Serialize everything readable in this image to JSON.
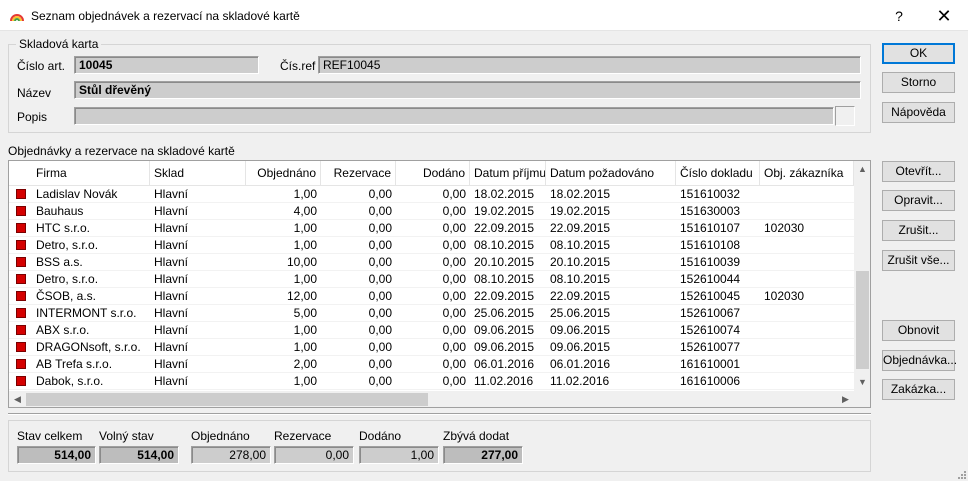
{
  "window": {
    "title": "Seznam objednávek a rezervací na skladové kartě",
    "help_label": "?",
    "close_label": "✕"
  },
  "card": {
    "group_title": "Skladová karta",
    "cislo_art_label": "Číslo art.",
    "cislo_art_value": "10045",
    "cis_ref_label": "Čís.ref",
    "cis_ref_value": "REF10045",
    "nazev_label": "Název",
    "nazev_value": "Stůl dřevěný",
    "popis_label": "Popis",
    "popis_value": ""
  },
  "orders": {
    "section_title": "Objednávky a rezervace na skladové kartě",
    "columns": [
      "Firma",
      "Sklad",
      "Objednáno",
      "Rezervace",
      "Dodáno",
      "Datum příjmu",
      "Datum požadováno",
      "Číslo dokladu",
      "Obj. zákazníka"
    ],
    "rows": [
      [
        "Ladislav Novák",
        "Hlavní",
        "1,00",
        "0,00",
        "0,00",
        "18.02.2015",
        "18.02.2015",
        "151610032",
        ""
      ],
      [
        "Bauhaus",
        "Hlavní",
        "4,00",
        "0,00",
        "0,00",
        "19.02.2015",
        "19.02.2015",
        "151630003",
        ""
      ],
      [
        "HTC s.r.o.",
        "Hlavní",
        "1,00",
        "0,00",
        "0,00",
        "22.09.2015",
        "22.09.2015",
        "151610107",
        "102030"
      ],
      [
        "Detro, s.r.o.",
        "Hlavní",
        "1,00",
        "0,00",
        "0,00",
        "08.10.2015",
        "08.10.2015",
        "151610108",
        ""
      ],
      [
        "BSS a.s.",
        "Hlavní",
        "10,00",
        "0,00",
        "0,00",
        "20.10.2015",
        "20.10.2015",
        "151610039",
        ""
      ],
      [
        "Detro, s.r.o.",
        "Hlavní",
        "1,00",
        "0,00",
        "0,00",
        "08.10.2015",
        "08.10.2015",
        "152610044",
        ""
      ],
      [
        "ČSOB, a.s.",
        "Hlavní",
        "12,00",
        "0,00",
        "0,00",
        "22.09.2015",
        "22.09.2015",
        "152610045",
        "102030"
      ],
      [
        "INTERMONT s.r.o.",
        "Hlavní",
        "5,00",
        "0,00",
        "0,00",
        "25.06.2015",
        "25.06.2015",
        "152610067",
        ""
      ],
      [
        "ABX s.r.o.",
        "Hlavní",
        "1,00",
        "0,00",
        "0,00",
        "09.06.2015",
        "09.06.2015",
        "152610074",
        ""
      ],
      [
        "DRAGONsoft, s.r.o.",
        "Hlavní",
        "1,00",
        "0,00",
        "0,00",
        "09.06.2015",
        "09.06.2015",
        "152610077",
        ""
      ],
      [
        "AB Trefa s.r.o.",
        "Hlavní",
        "2,00",
        "0,00",
        "0,00",
        "06.01.2016",
        "06.01.2016",
        "161610001",
        ""
      ],
      [
        "Dabok, s.r.o.",
        "Hlavní",
        "1,00",
        "0,00",
        "0,00",
        "11.02.2016",
        "11.02.2016",
        "161610006",
        ""
      ]
    ],
    "marker_color": "#d40000"
  },
  "totals": {
    "stav_celkem_label": "Stav celkem",
    "stav_celkem_value": "514,00",
    "volny_stav_label": "Volný stav",
    "volny_stav_value": "514,00",
    "objednano_label": "Objednáno",
    "objednano_value": "278,00",
    "rezervace_label": "Rezervace",
    "rezervace_value": "0,00",
    "dodano_label": "Dodáno",
    "dodano_value": "1,00",
    "zbyva_label": "Zbývá dodat",
    "zbyva_value": "277,00"
  },
  "buttons": {
    "ok": "OK",
    "storno": "Storno",
    "napoveda": "Nápověda",
    "otevrit": "Otevřít...",
    "opravit": "Opravit...",
    "zrusit": "Zrušit...",
    "zrusit_vse": "Zrušit vše...",
    "obnovit": "Obnovit",
    "objednavka": "Objednávka...",
    "zakazka": "Zakázka..."
  }
}
